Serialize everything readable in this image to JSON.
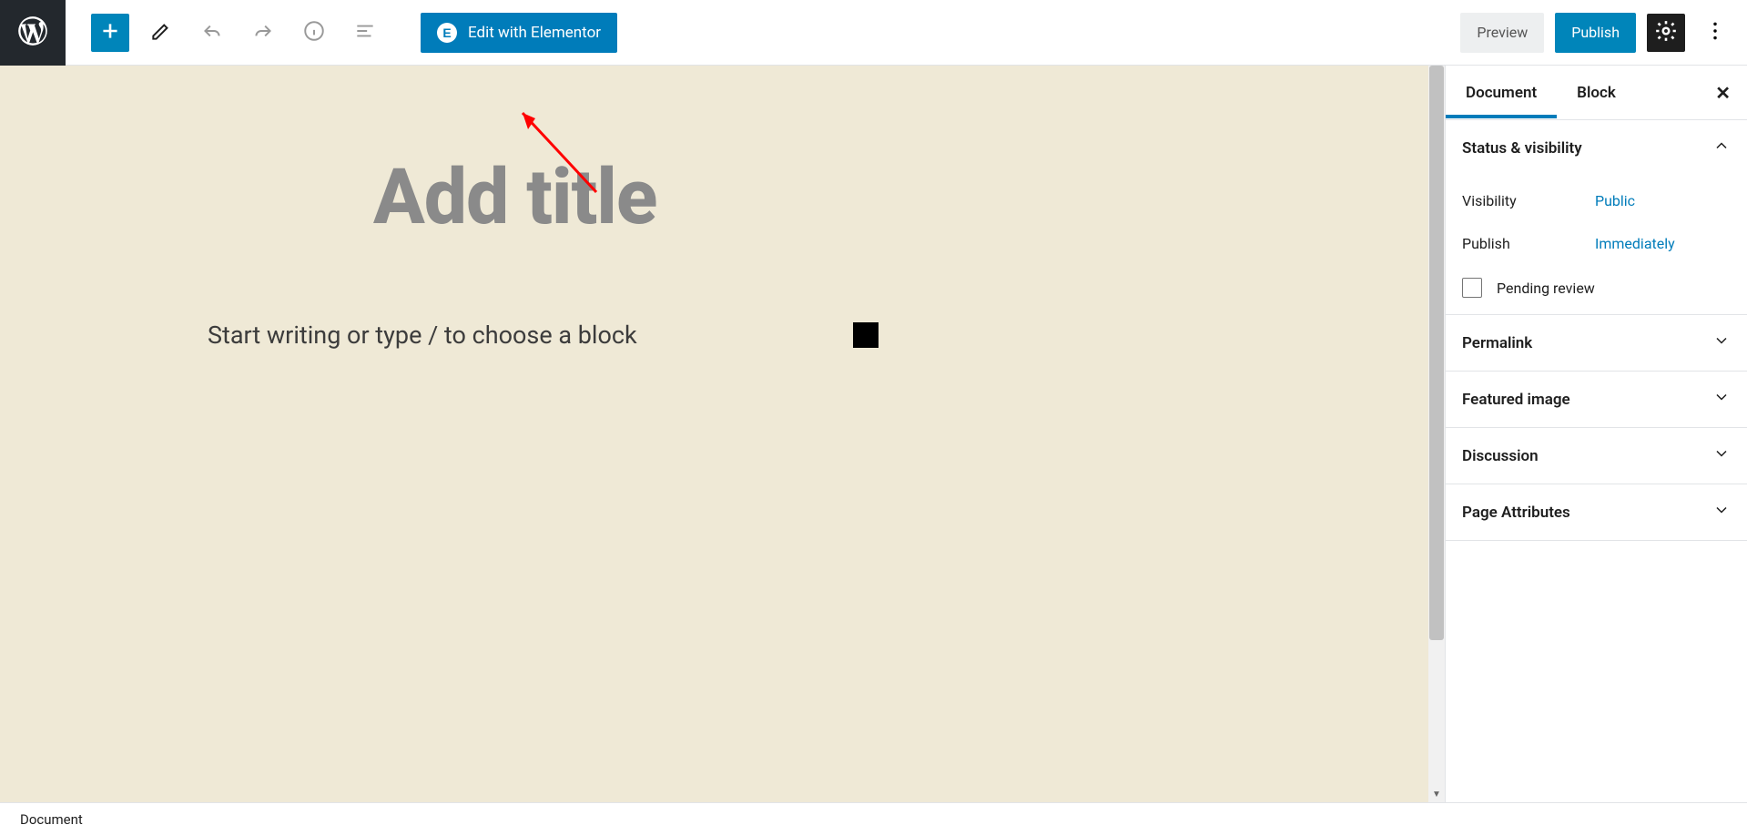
{
  "topbar": {
    "elementor_label": "Edit with Elementor",
    "preview_label": "Preview",
    "publish_label": "Publish"
  },
  "editor": {
    "title_placeholder": "Add title",
    "start_placeholder": "Start writing or type / to choose a block"
  },
  "sidebar": {
    "tab_document": "Document",
    "tab_block": "Block",
    "sections": {
      "status": {
        "title": "Status & visibility",
        "visibility_label": "Visibility",
        "visibility_value": "Public",
        "publish_label": "Publish",
        "publish_value": "Immediately",
        "pending_label": "Pending review"
      },
      "permalink": "Permalink",
      "featured_image": "Featured image",
      "discussion": "Discussion",
      "page_attributes": "Page Attributes"
    }
  },
  "footer": {
    "breadcrumb": "Document"
  }
}
